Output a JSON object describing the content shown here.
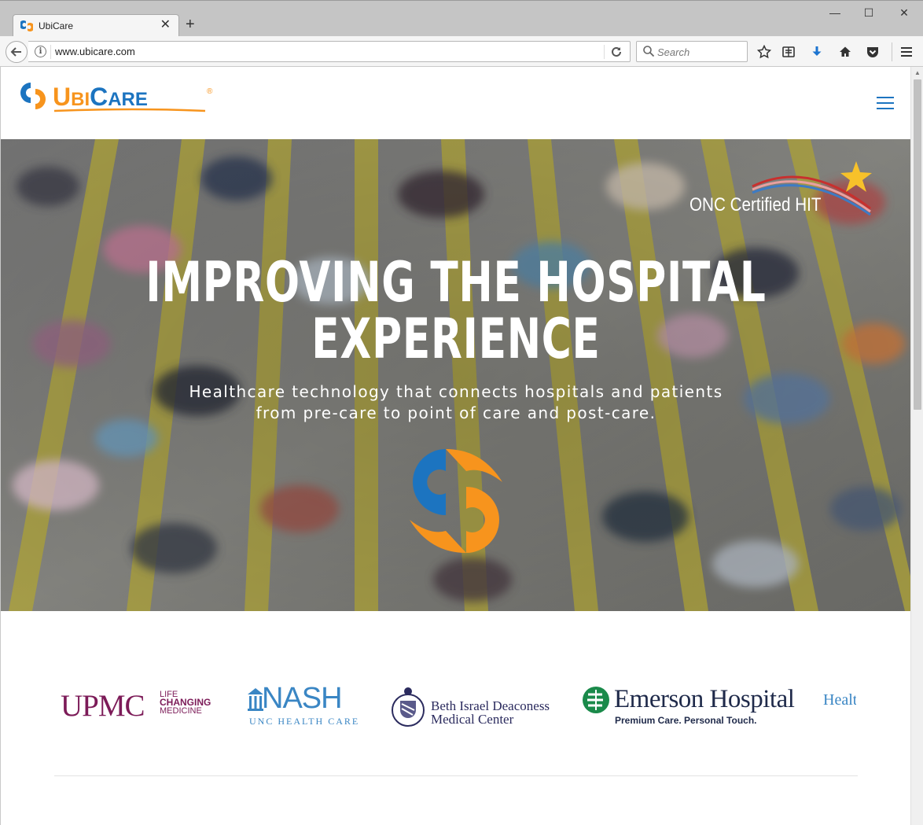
{
  "browser": {
    "tab_title": "UbiCare",
    "tab_close": "✕",
    "new_tab": "+",
    "window_controls": {
      "minimize": "—",
      "maximize": "☐",
      "close": "✕"
    },
    "url": "www.ubicare.com",
    "search_placeholder": "Search",
    "toolbar_icons": [
      "star-icon",
      "reading-list-icon",
      "download-icon",
      "home-icon",
      "pocket-icon",
      "menu-icon"
    ]
  },
  "site": {
    "logo_text": "UBICARE",
    "logo_parts": {
      "first": "U",
      "small1": "BI",
      "second": "C",
      "small2": "ARE",
      "mark": "®"
    },
    "brand_colors": {
      "blue": "#1c74c0",
      "orange": "#f7941d"
    }
  },
  "hero": {
    "badge": "ONC Certified HIT",
    "title_line1": "IMPROVING THE HOSPITAL",
    "title_line2": "EXPERIENCE",
    "subtitle_line1": "Healthcare technology that connects hospitals and patients",
    "subtitle_line2": "from pre-care to point of care and post-care."
  },
  "partners": {
    "upmc": {
      "word": "UPMC",
      "tag": [
        "LIFE",
        "CHANGING",
        "MEDICINE"
      ]
    },
    "nash": {
      "word": "NASH",
      "sub": "UNC HEALTH CARE"
    },
    "bidmc": {
      "line1": "Beth Israel Deaconess",
      "line2": "Medical Center"
    },
    "emerson": {
      "word": "Emerson Hospital",
      "tag": "Premium Care. Personal Touch."
    },
    "partial": {
      "word": "Healt"
    }
  }
}
